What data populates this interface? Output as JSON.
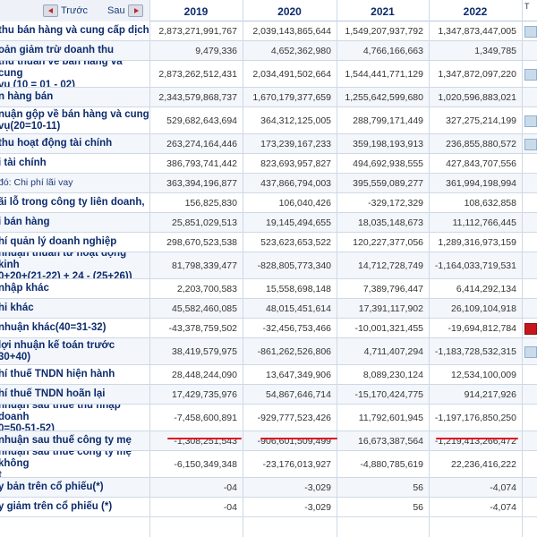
{
  "nav": {
    "prev_label": "Trước",
    "next_label": "Sau"
  },
  "years": [
    "2019",
    "2020",
    "2021",
    "2022"
  ],
  "edge_header": "T",
  "rows": [
    {
      "label": "thu bán hàng và cung cấp dịch",
      "values": [
        "2,873,271,991,767",
        "2,039,143,865,644",
        "1,549,207,937,792",
        "1,347,873,447,005"
      ]
    },
    {
      "label": "oản giảm trừ doanh thu",
      "values": [
        "9,479,336",
        "4,652,362,980",
        "4,766,166,663",
        "1,349,785"
      ]
    },
    {
      "label": "thu thuần về bán hàng và cung\nvụ (10 = 01 - 02)",
      "values": [
        "2,873,262,512,431",
        "2,034,491,502,664",
        "1,544,441,771,129",
        "1,347,872,097,220"
      ]
    },
    {
      "label": "n hàng bán",
      "values": [
        "2,343,579,868,737",
        "1,670,179,377,659",
        "1,255,642,599,680",
        "1,020,596,883,021"
      ]
    },
    {
      "label": "nuận gộp về bán hàng và cung\nvụ(20=10-11)",
      "values": [
        "529,682,643,694",
        "364,312,125,005",
        "288,799,171,449",
        "327,275,214,199"
      ]
    },
    {
      "label": "thu hoạt động tài chính",
      "values": [
        "263,274,164,446",
        "173,239,167,233",
        "359,198,193,913",
        "236,855,880,572"
      ]
    },
    {
      "label": "i tài chính",
      "values": [
        "386,793,741,442",
        "823,693,957,827",
        "494,692,938,555",
        "427,843,707,556"
      ]
    },
    {
      "label": "đó: Chi phí lãi vay",
      "plain": true,
      "values": [
        "363,394,196,877",
        "437,866,794,003",
        "395,559,089,277",
        "361,994,198,994"
      ]
    },
    {
      "label": "ãi lỗ trong công ty liên doanh,",
      "values": [
        "156,825,830",
        "106,040,426",
        "-329,172,329",
        "108,632,858"
      ]
    },
    {
      "label": "i bán hàng",
      "values": [
        "25,851,029,513",
        "19,145,494,655",
        "18,035,148,673",
        "11,112,766,445"
      ]
    },
    {
      "label": "hí quản lý doanh nghiệp",
      "values": [
        "298,670,523,538",
        "523,623,653,522",
        "120,227,377,056",
        "1,289,316,973,159"
      ]
    },
    {
      "label": "nhuận thuần từ hoạt động kinh\n0+20+(21-22) + 24 - (25+26))",
      "values": [
        "81,798,339,477",
        "-828,805,773,340",
        "14,712,728,749",
        "-1,164,033,719,531"
      ]
    },
    {
      "label": "nhập khác",
      "values": [
        "2,203,700,583",
        "15,558,698,148",
        "7,389,796,447",
        "6,414,292,134"
      ]
    },
    {
      "label": "hi khác",
      "values": [
        "45,582,460,085",
        "48,015,451,614",
        "17,391,117,902",
        "26,109,104,918"
      ]
    },
    {
      "label": "nhuận khác(40=31-32)",
      "values": [
        "-43,378,759,502",
        "-32,456,753,466",
        "-10,001,321,455",
        "-19,694,812,784"
      ]
    },
    {
      "label": "lợi nhuận kế toán trước\n30+40)",
      "values": [
        "38,419,579,975",
        "-861,262,526,806",
        "4,711,407,294",
        "-1,183,728,532,315"
      ]
    },
    {
      "label": "hí thuế TNDN hiện hành",
      "values": [
        "28,448,244,090",
        "13,647,349,906",
        "8,089,230,124",
        "12,534,100,009"
      ]
    },
    {
      "label": "hí thuế TNDN hoãn lại",
      "values": [
        "17,429,735,976",
        "54,867,646,714",
        "-15,170,424,775",
        "914,217,926"
      ]
    },
    {
      "label": "nhuận sau thuế thu nhập doanh\n0=50-51-52)",
      "values": [
        "-7,458,600,891",
        "-929,777,523,426",
        "11,792,601,945",
        "-1,197,176,850,250"
      ]
    },
    {
      "label": "nhuận sau thuế công ty mẹ",
      "values": [
        "-1,308,251,543",
        "-906,601,509,499",
        "16,673,387,564",
        "-1,219,413,266,472"
      ]
    },
    {
      "label": "nhuận sau thuế công ty mẹ không\nt",
      "values": [
        "-6,150,349,348",
        "-23,176,013,927",
        "-4,880,785,619",
        "22,236,416,222"
      ]
    },
    {
      "label": "y bản trên cổ phiếu(*)",
      "values": [
        "-04",
        "-3,029",
        "56",
        "-4,074"
      ]
    },
    {
      "label": "y giảm trên cổ phiếu (*)",
      "values": [
        "-04",
        "-3,029",
        "56",
        "-4,074"
      ]
    }
  ]
}
